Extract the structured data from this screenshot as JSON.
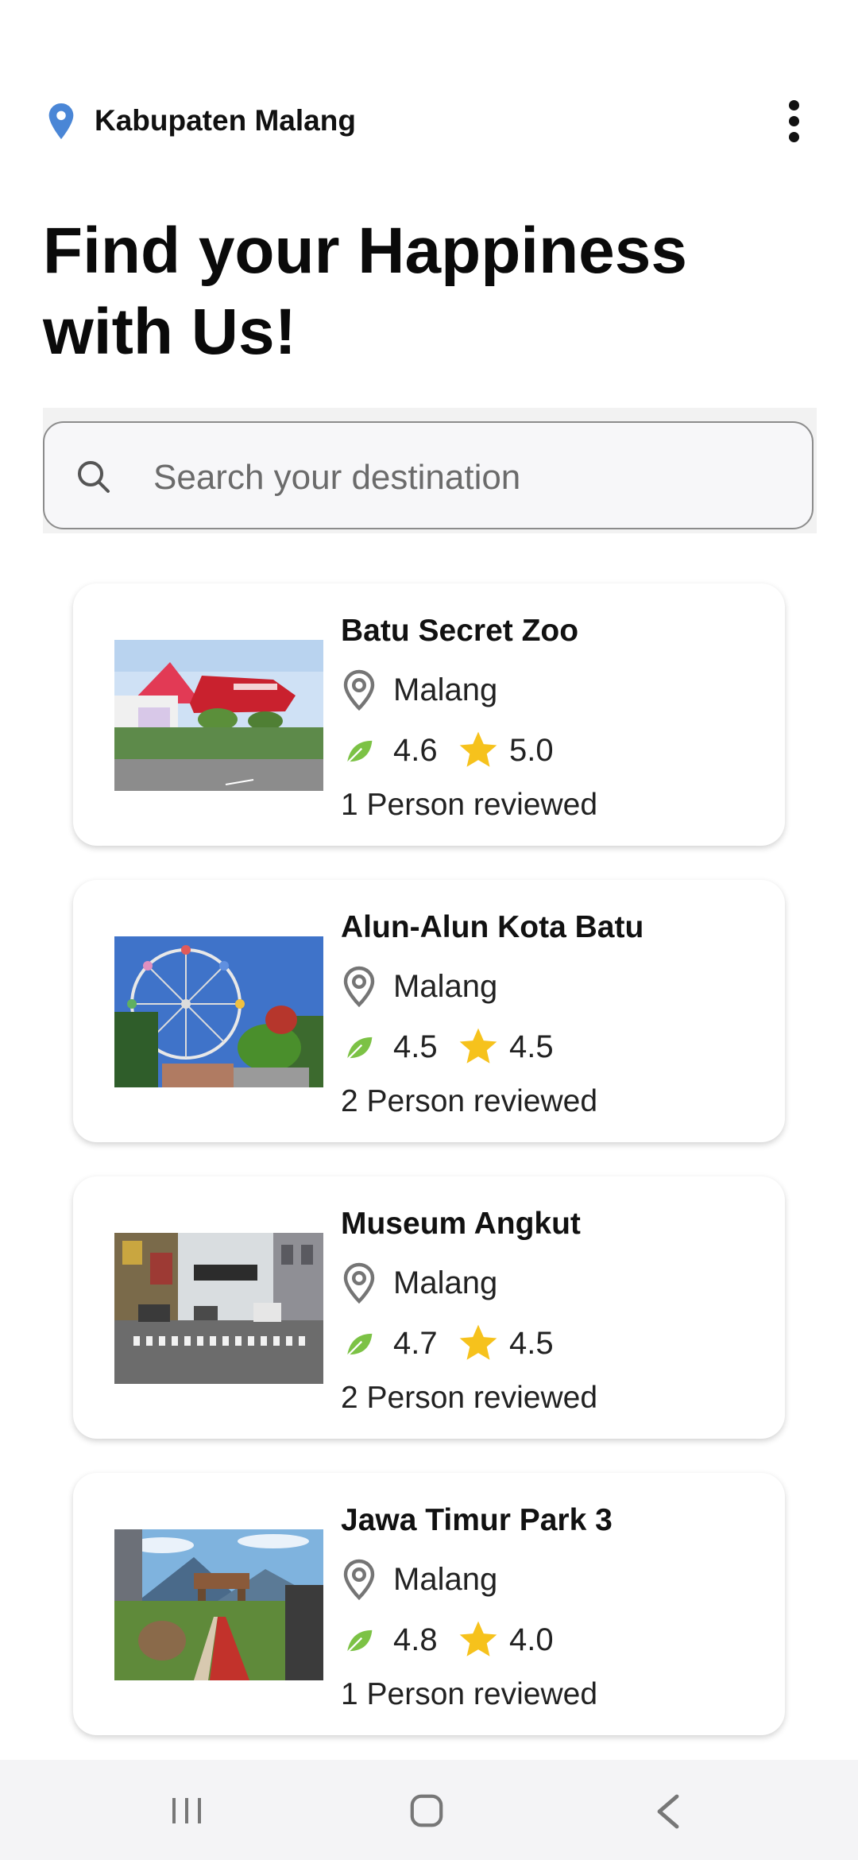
{
  "header": {
    "location": "Kabupaten Malang",
    "location_icon": "location-pin-icon",
    "menu_icon": "more-vertical-icon"
  },
  "hero": {
    "line1": "Find your Happiness",
    "line2": "with Us!"
  },
  "search": {
    "placeholder": "Search your destination",
    "value": ""
  },
  "colors": {
    "accent_pin": "#4a86d6",
    "star": "#f6c21c",
    "leaf": "#7cc245",
    "city_pin": "#757575"
  },
  "destinations": [
    {
      "name": "Batu Secret Zoo",
      "city": "Malang",
      "eco_rating": "4.6",
      "star_rating": "5.0",
      "reviews": "1 Person reviewed"
    },
    {
      "name": "Alun-Alun Kota Batu",
      "city": "Malang",
      "eco_rating": "4.5",
      "star_rating": "4.5",
      "reviews": "2 Person reviewed"
    },
    {
      "name": "Museum Angkut",
      "city": "Malang",
      "eco_rating": "4.7",
      "star_rating": "4.5",
      "reviews": "2 Person reviewed"
    },
    {
      "name": "Jawa Timur Park 3",
      "city": "Malang",
      "eco_rating": "4.8",
      "star_rating": "4.0",
      "reviews": "1 Person reviewed"
    }
  ],
  "system_nav": {
    "recent_icon": "recent-apps-icon",
    "home_icon": "home-icon",
    "back_icon": "back-icon"
  }
}
